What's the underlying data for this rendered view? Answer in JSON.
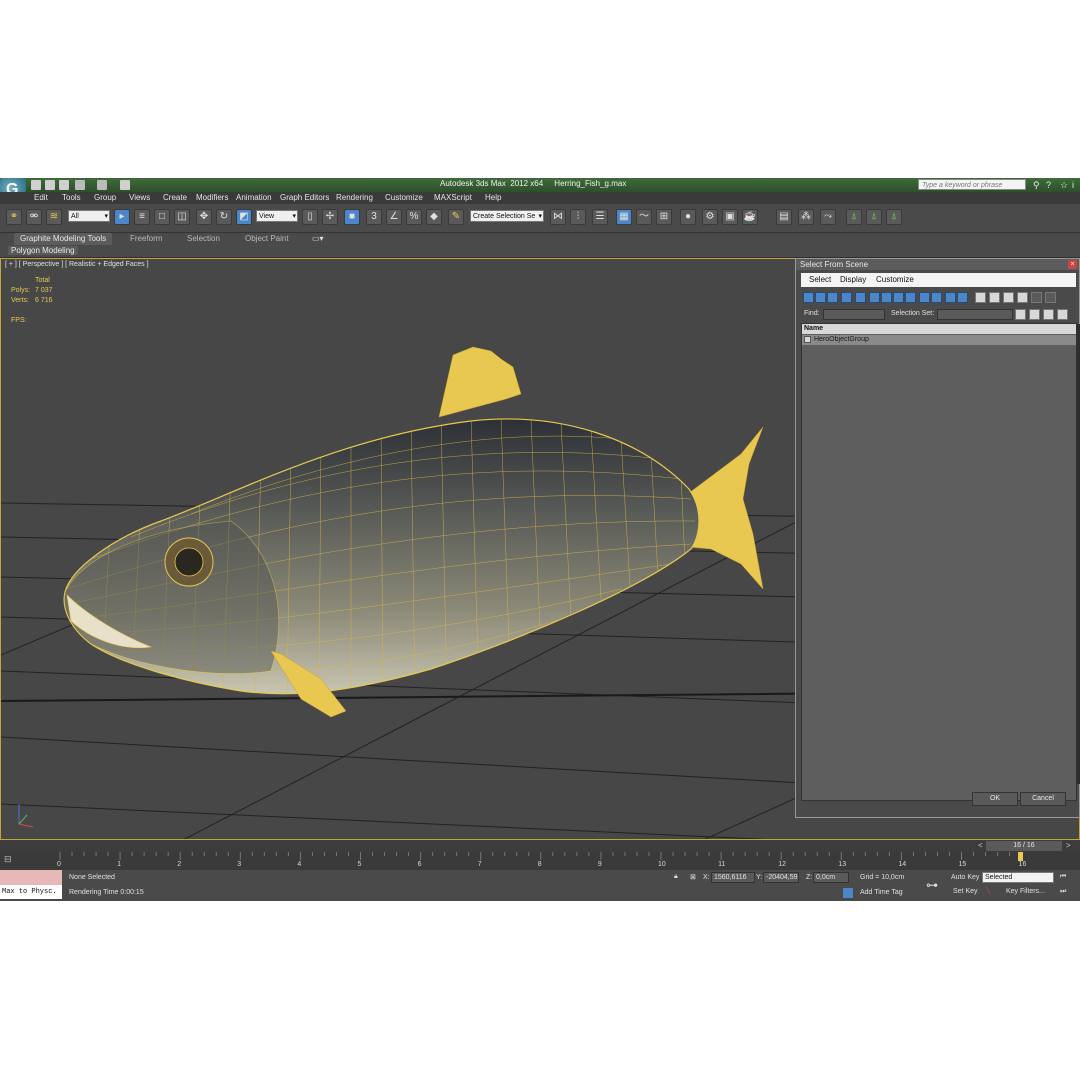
{
  "window": {
    "title": "Autodesk 3ds Max  2012 x64     Herring_Fish_g.max",
    "search_placeholder": "Type a keyword or phrase"
  },
  "menu": [
    "Edit",
    "Tools",
    "Group",
    "Views",
    "Create",
    "Modifiers",
    "Animation",
    "Graph Editors",
    "Rendering",
    "Customize",
    "MAXScript",
    "Help"
  ],
  "toolbar": {
    "selection_filter": "All",
    "reference_coord": "View",
    "named_selection": "Create Selection Se",
    "snap_labels": [
      "3",
      "%"
    ]
  },
  "ribbon": {
    "tabs": [
      "Graphite Modeling Tools",
      "Freeform",
      "Selection",
      "Object Paint"
    ],
    "panel": "Polygon Modeling"
  },
  "viewport": {
    "label": "[ + ] [ Perspective ] [ Realistic + Edged Faces ]",
    "stats": {
      "total_label": "Total",
      "polys_label": "Polys:",
      "polys_value": "7 037",
      "verts_label": "Verts:",
      "verts_value": "6 716",
      "fps_label": "FPS:"
    },
    "axis_labels": [
      "x",
      "y",
      "z"
    ]
  },
  "dialog": {
    "title": "Select From Scene",
    "close": "×",
    "menus": [
      "Select",
      "Display",
      "Customize"
    ],
    "find_label": "Find:",
    "selection_set_label": "Selection Set:",
    "column_name": "Name",
    "items": [
      "HeroObjectGroup"
    ],
    "ok": "OK",
    "cancel": "Cancel"
  },
  "timeline": {
    "readout": "16 / 16",
    "ticks": [
      "0",
      "1",
      "2",
      "3",
      "4",
      "5",
      "6",
      "7",
      "8",
      "9",
      "10",
      "11",
      "12",
      "13",
      "14",
      "15",
      "16"
    ]
  },
  "status": {
    "maxscript_output": "Max to Physc.",
    "selection": "None Selected",
    "prompt": "Rendering Time  0:00:15",
    "x_label": "X:",
    "x_value": "1560,6116",
    "y_label": "Y:",
    "y_value": "-20404,59",
    "z_label": "Z:",
    "z_value": "0,0cm",
    "grid": "Grid = 10,0cm",
    "add_time_tag": "Add Time Tag",
    "auto_key": "Auto Key",
    "set_key": "Set Key",
    "key_mode": "Selected",
    "key_filters": "Key Filters..."
  },
  "colors": {
    "wireframe": "#e8c850",
    "viewport_bg": "#474747",
    "accent_blue": "#4a86c8"
  }
}
